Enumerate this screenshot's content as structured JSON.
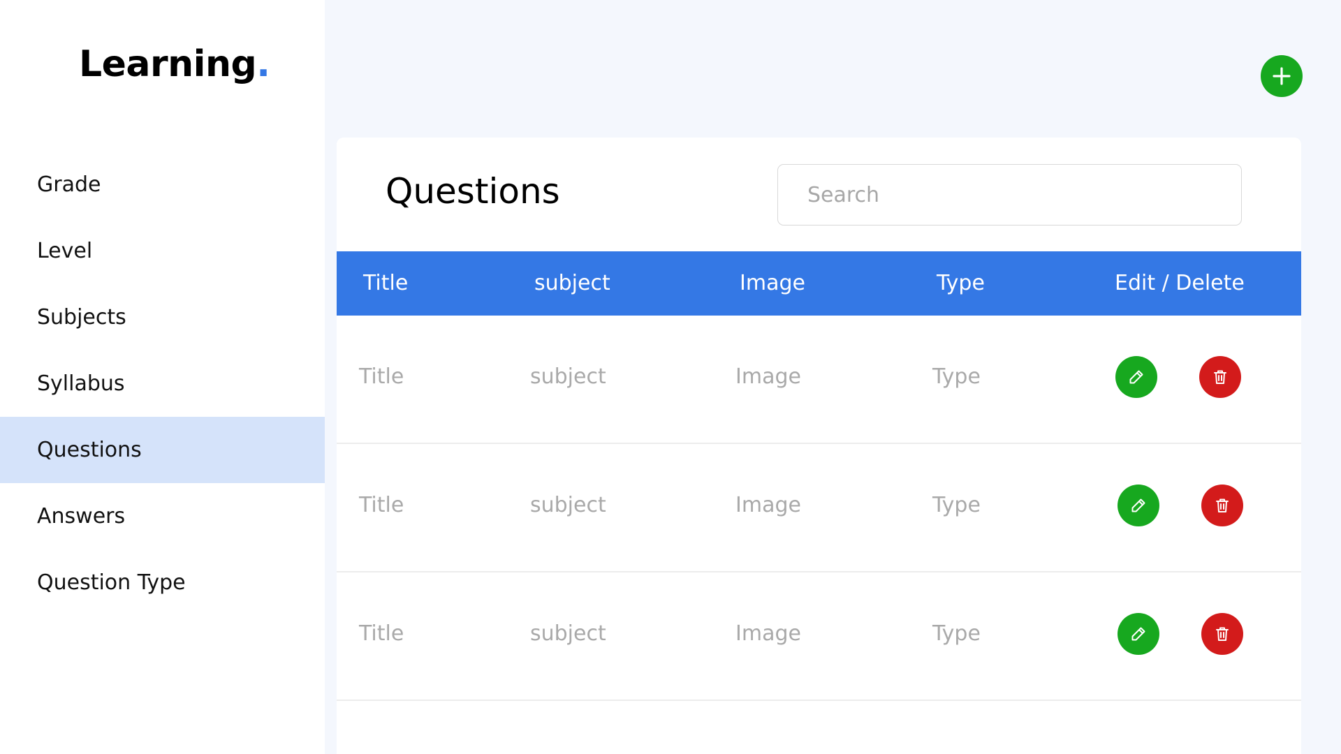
{
  "sidebar": {
    "brand": "Learning",
    "brand_dot": ".",
    "items": [
      {
        "label": "Grade"
      },
      {
        "label": "Level"
      },
      {
        "label": "Subjects"
      },
      {
        "label": "Syllabus"
      },
      {
        "label": "Questions",
        "active": true
      },
      {
        "label": "Answers"
      },
      {
        "label": "Question Type"
      }
    ]
  },
  "toolbar": {
    "add_icon": "plus-icon"
  },
  "main": {
    "title": "Questions",
    "search": {
      "placeholder": "Search",
      "value": ""
    },
    "table": {
      "columns": [
        "Title",
        "subject",
        "Image",
        "Type",
        "Edit / Delete"
      ],
      "rows": [
        {
          "title": "Title",
          "subject": "subject",
          "image": "Image",
          "type": "Type"
        },
        {
          "title": "Title",
          "subject": "subject",
          "image": "Image",
          "type": "Type"
        },
        {
          "title": "Title",
          "subject": "subject",
          "image": "Image",
          "type": "Type"
        }
      ],
      "edit_icon": "pencil-icon",
      "delete_icon": "trash-icon"
    }
  },
  "colors": {
    "accent": "#3478e5",
    "active_nav_bg": "#d5e3fa",
    "edit_green": "#17a81f",
    "delete_red": "#d31b1b",
    "page_bg": "#f4f7fd"
  }
}
